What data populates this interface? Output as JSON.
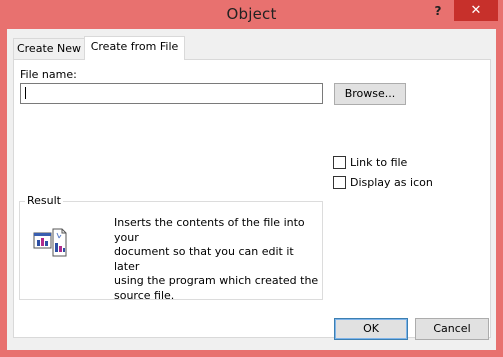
{
  "window": {
    "title": "Object",
    "help_glyph": "?",
    "close_glyph": "✕",
    "accent_color": "#e8716f"
  },
  "tabs": [
    {
      "label": "Create New",
      "selected": false
    },
    {
      "label": "Create from File",
      "selected": true
    }
  ],
  "file_name": {
    "label": "File name:",
    "value": "",
    "placeholder": ""
  },
  "browse_label": "Browse...",
  "checkboxes": {
    "link": {
      "label": "Link to file",
      "checked": false
    },
    "display_icon": {
      "label": "Display as icon",
      "checked": false
    }
  },
  "result": {
    "title": "Result",
    "icon": "document-icon",
    "text": "Inserts the contents of the file into your\ndocument so that you can edit it later\nusing the program which created the\nsource file."
  },
  "buttons": {
    "ok": "OK",
    "cancel": "Cancel"
  }
}
